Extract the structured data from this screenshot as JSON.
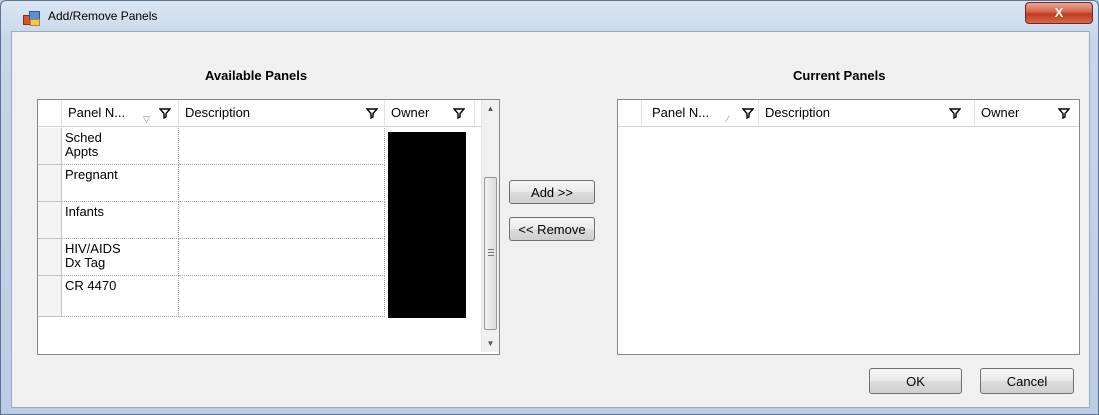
{
  "window": {
    "title": "Add/Remove Panels",
    "close_glyph": "X",
    "icon": "panels-window-icon"
  },
  "available": {
    "title": "Available Panels",
    "columns": {
      "panel_name": "Panel N...",
      "description": "Description",
      "owner": "Owner"
    },
    "sort_indicator": "descending",
    "rows": [
      {
        "panel_name": "Sched Appts",
        "description": ""
      },
      {
        "panel_name": "Pregnant",
        "description": ""
      },
      {
        "panel_name": "Infants",
        "description": ""
      },
      {
        "panel_name": "HIV/AIDS Dx Tag",
        "description": ""
      },
      {
        "panel_name": "CR 4470",
        "description": ""
      }
    ],
    "owner_values_redacted": true
  },
  "current": {
    "title": "Current Panels",
    "columns": {
      "panel_name": "Panel N...",
      "description": "Description",
      "owner": "Owner"
    },
    "sort_indicator": "ascending",
    "rows": []
  },
  "buttons": {
    "add": "Add >>",
    "remove": "<< Remove",
    "ok": "OK",
    "cancel": "Cancel"
  },
  "icons": [
    "filter-icon",
    "sort-indicator-icon",
    "scroll-up-icon",
    "scroll-down-icon",
    "close-icon"
  ],
  "colors": {
    "titlebar": "#c6d6ea",
    "close_button": "#c2391b",
    "dialog_bg": "#f0f0f0",
    "redaction": "#000000"
  }
}
